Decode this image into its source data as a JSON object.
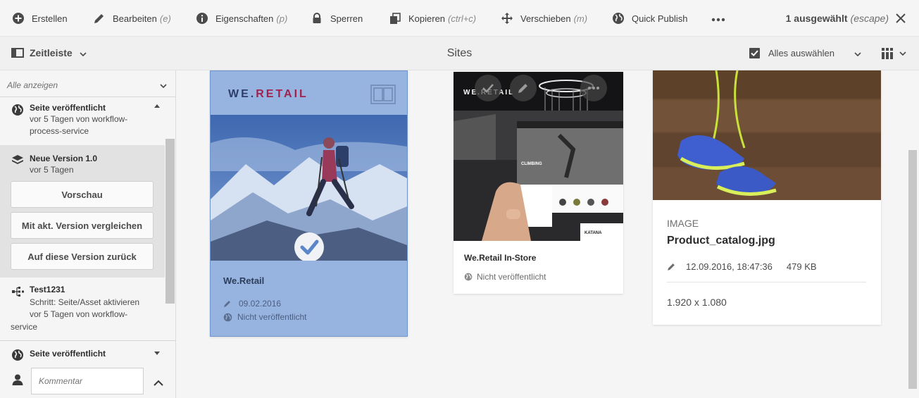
{
  "actionbar": {
    "create": {
      "label": "Erstellen",
      "hint": ""
    },
    "edit": {
      "label": "Bearbeiten",
      "hint": "(e)"
    },
    "properties": {
      "label": "Eigenschaften",
      "hint": "(p)"
    },
    "lock": {
      "label": "Sperren",
      "hint": ""
    },
    "copy": {
      "label": "Kopieren",
      "hint": "(ctrl+c)"
    },
    "move": {
      "label": "Verschieben",
      "hint": "(m)"
    },
    "quick_publish": {
      "label": "Quick Publish",
      "hint": ""
    },
    "more_icon": "more-horizontal-icon",
    "selection_count": "1 ausgewählt",
    "selection_hint": "(escape)"
  },
  "subbar": {
    "rail_label": "Zeitleiste",
    "title": "Sites",
    "select_all": "Alles auswählen"
  },
  "timeline": {
    "filter": "Alle anzeigen",
    "items": [
      {
        "title": "Seite veröffentlicht",
        "sub1": "vor 5 Tagen von workflow-",
        "sub2": "process-service",
        "icon": "globe-icon"
      },
      {
        "title": "Neue Version 1.0",
        "sub1": "vor 5 Tagen",
        "icon": "layers-icon",
        "buttons": [
          "Vorschau",
          "Mit akt. Version vergleichen",
          "Auf diese Version zurück"
        ]
      },
      {
        "title": "Test1231",
        "sub1": "Schritt: Seite/Asset aktivieren",
        "sub2": "vor 5 Tagen von workflow-",
        "sub3": "service",
        "icon": "workflow-icon"
      },
      {
        "title": "Seite veröffentlicht",
        "icon": "globe-icon"
      }
    ],
    "comment_placeholder": "Kommentar"
  },
  "cards": [
    {
      "brand_text": "WE.",
      "brand_accent": "RETAIL",
      "title": "We.Retail",
      "date": "09.02.2016",
      "status": "Nicht veröffentlicht",
      "selected": true
    },
    {
      "title": "We.Retail In-Store",
      "status": "Nicht veröffentlicht",
      "selected": false,
      "screen_brand": "WE.RETAIL",
      "screen_heading": "CLIMBING",
      "screen_product": "KATANA"
    },
    {
      "type": "IMAGE",
      "title": "Product_catalog.jpg",
      "date": "12.09.2016, 18:47:36",
      "size": "479 KB",
      "dimensions": "1.920 x 1.080",
      "selected": false
    }
  ],
  "colors": {
    "accent": "#2680eb",
    "selected_card": "#97b4e1",
    "brand_red": "#a0224e"
  }
}
